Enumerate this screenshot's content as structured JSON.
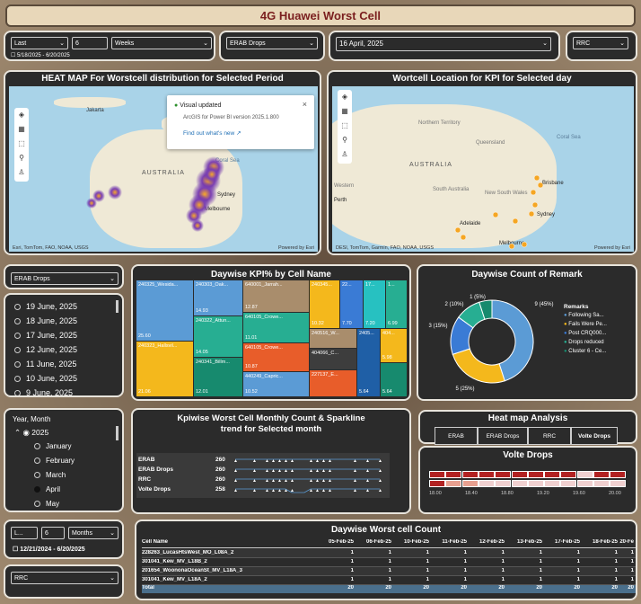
{
  "app": {
    "title": "4G Huawei Worst Cell"
  },
  "filters": {
    "period_type": "Last",
    "period_count": "6",
    "period_unit": "Weeks",
    "period_range": "5/18/2025 - 6/20/2025",
    "kpi": "ERAB Drops",
    "date": "16 April, 2025",
    "kpi2": "RRC"
  },
  "heatmap": {
    "title": "HEAT MAP For Worstcell distribution for Selected Period",
    "attribution": "Esri, TomTom, FAO, NOAA, USGS",
    "powered": "Powered by Esri",
    "labels": {
      "jakarta": "Jakarta",
      "australia": "AUSTRALIA",
      "coral": "Coral Sea",
      "sydney": "Sydney",
      "melbourne": "Melbourne"
    },
    "popup": {
      "title": "Visual updated",
      "body": "ArcGIS for Power BI version 2025.1.800",
      "link": "Find out what's new"
    }
  },
  "location_map": {
    "title": "Wortcell Location for KPI for Selected day",
    "attribution": "DESI, TomTom, Garmin, FAO, NOAA, USGS",
    "powered": "Powered by Esri",
    "labels": {
      "nt": "Northern Territory",
      "qld": "Queensland",
      "coral": "Coral Sea",
      "australia": "AUSTRALIA",
      "wa": "Western",
      "perth": "Perth",
      "sa": "South Australia",
      "nsw": "New South Wales",
      "brisbane": "Brisbane",
      "sydney": "Sydney",
      "adelaide": "Adelaide",
      "melbourne": "Melbourne"
    }
  },
  "kpi_filter": "ERAB Drops",
  "dates": [
    "19 June, 2025",
    "18 June, 2025",
    "17 June, 2025",
    "12 June, 2025",
    "11 June, 2025",
    "10 June, 2025",
    "9 June, 2025"
  ],
  "year_month": {
    "header": "Year, Month",
    "year": "2025",
    "months": [
      "January",
      "February",
      "March",
      "April",
      "May"
    ],
    "selected": "April"
  },
  "range_filter": {
    "type": "L...",
    "count": "6",
    "unit": "Months",
    "range": "12/21/2024 - 6/20/2025"
  },
  "rrc_filter": "RRC",
  "treemap": {
    "title": "Daywise KPI% by Cell Name",
    "cells": [
      {
        "name": "240325_Wesida...",
        "value": "25.60",
        "color": "#5b9bd5"
      },
      {
        "name": "240323_Hallsvil...",
        "value": "21.06",
        "color": "#f4b81c"
      },
      {
        "name": "240303_Oak...",
        "value": "14.93",
        "color": "#5b9bd5"
      },
      {
        "name": "240322_Attun...",
        "value": "14.05",
        "color": "#27ae92"
      },
      {
        "name": "240341_Billm...",
        "value": "12.01",
        "color": "#178a6e"
      },
      {
        "name": "640001_Jarrah...",
        "value": "12.87",
        "color": "#a98d6c"
      },
      {
        "name": "640105_Crowe...",
        "value": "11.01",
        "color": "#27ae92"
      },
      {
        "name": "640105_Crowe...",
        "value": "10.87",
        "color": "#e85d2a"
      },
      {
        "name": "440249_Capric...",
        "value": "10.52",
        "color": "#5b9bd5"
      },
      {
        "name": "240345...",
        "value": "10.32",
        "color": "#f4b81c"
      },
      {
        "name": "22...",
        "value": "7.70",
        "color": "#3a7bd5"
      },
      {
        "name": "17...",
        "value": "7.20",
        "color": "#27c1c1"
      },
      {
        "name": "1...",
        "value": "6.99",
        "color": "#27ae92"
      },
      {
        "name": "240516_W...",
        "value": "",
        "color": "#a98d6c"
      },
      {
        "name": "404066_C...",
        "value": "",
        "color": "#3d3d3d"
      },
      {
        "name": "227137_E...",
        "value": "",
        "color": "#e85d2a"
      },
      {
        "name": "2405...",
        "value": "5.64",
        "color": "#1f5fa6"
      },
      {
        "name": "404...",
        "value": "5.98",
        "color": "#f4b81c"
      },
      {
        "name": "",
        "value": "5.64",
        "color": "#178a6e"
      }
    ]
  },
  "donut": {
    "title": "Daywise Count of Remark",
    "legend_title": "Remarks",
    "slices": [
      {
        "label": "Following Sa...",
        "count": 9,
        "pct": "(45%)",
        "color": "#5b9bd5"
      },
      {
        "label": "Fails Were Pe...",
        "count": 5,
        "pct": "(25%)",
        "color": "#f4b81c"
      },
      {
        "label": "Post CRQ000...",
        "count": 3,
        "pct": "(15%)",
        "color": "#3a7bd5"
      },
      {
        "label": "Drops reduced",
        "count": 2,
        "pct": "(10%)",
        "color": "#27ae92"
      },
      {
        "label": "Cluster 6 - Ce...",
        "count": 1,
        "pct": "(5%)",
        "color": "#178a6e"
      }
    ]
  },
  "sparkline": {
    "title": "Kpiwise Worst Cell Monthly Count & Sparkline trend for Selected month",
    "rows": [
      {
        "kpi": "ERAB",
        "count": "260"
      },
      {
        "kpi": "ERAB Drops",
        "count": "260"
      },
      {
        "kpi": "RRC",
        "count": "260"
      },
      {
        "kpi": "Volte Drops",
        "count": "258"
      }
    ]
  },
  "heatmap_analysis": {
    "title": "Heat map Analysis",
    "buttons": [
      "ERAB",
      "ERAB Drops",
      "RRC",
      "Volte Drops"
    ]
  },
  "volte": {
    "title": "Volte Drops",
    "ticks": [
      "18.00",
      "18.40",
      "18.80",
      "19.20",
      "19.60",
      "20.00"
    ]
  },
  "worst_table": {
    "title": "Daywise Worst cell Count",
    "headers": [
      "Cell Name",
      "05-Feb-25",
      "06-Feb-25",
      "10-Feb-25",
      "11-Feb-25",
      "12-Feb-25",
      "13-Feb-25",
      "17-Feb-25",
      "18-Feb-25",
      "20-Fe"
    ],
    "rows": [
      [
        "228263_LucasHtsWest_MO_L08A_2",
        "1",
        "1",
        "1",
        "1",
        "1",
        "1",
        "1",
        "1",
        "1"
      ],
      [
        "301041_Kew_MV_L18B_2",
        "1",
        "1",
        "1",
        "1",
        "1",
        "1",
        "1",
        "1",
        "1"
      ],
      [
        "201654_WoononaOceanSt_MV_L18A_3",
        "1",
        "1",
        "1",
        "1",
        "1",
        "1",
        "1",
        "1",
        "1"
      ],
      [
        "301041_Kew_MV_L18A_2",
        "1",
        "1",
        "1",
        "1",
        "1",
        "1",
        "1",
        "1",
        "1"
      ]
    ],
    "total": [
      "Total",
      "20",
      "20",
      "20",
      "20",
      "20",
      "20",
      "20",
      "20",
      "20"
    ]
  }
}
